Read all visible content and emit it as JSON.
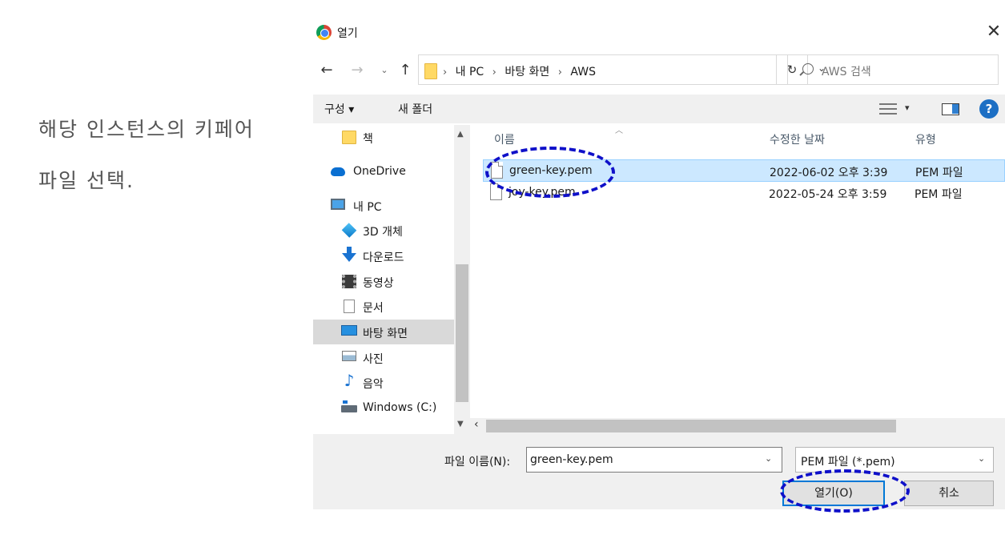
{
  "note": {
    "line1": "해당 인스턴스의 키페어",
    "line2": "파일 선택."
  },
  "dialog": {
    "title": "열기",
    "close_glyph": "✕",
    "nav": {
      "back": "←",
      "forward": "→",
      "recent": "⌄",
      "up": "↑",
      "refresh": "↻",
      "dropdown": "⌄"
    },
    "breadcrumb": [
      "내 PC",
      "바탕 화면",
      "AWS"
    ],
    "breadcrumb_sep": "›",
    "search_placeholder": "AWS 검색",
    "toolbar": {
      "organize": "구성 ▾",
      "new_folder": "새 폴더",
      "view_drop": "▾",
      "help": "?"
    },
    "nav_items": [
      {
        "label": "책",
        "icon": "folder-icon"
      },
      {
        "label": "OneDrive",
        "icon": "onedrive-icon"
      },
      {
        "label": "내 PC",
        "icon": "pc-icon"
      },
      {
        "label": "3D 개체",
        "icon": "3d-objects-icon"
      },
      {
        "label": "다운로드",
        "icon": "download-icon"
      },
      {
        "label": "동영상",
        "icon": "video-icon"
      },
      {
        "label": "문서",
        "icon": "document-icon"
      },
      {
        "label": "바탕 화면",
        "icon": "desktop-icon",
        "selected": true
      },
      {
        "label": "사진",
        "icon": "pictures-icon"
      },
      {
        "label": "음악",
        "icon": "music-icon"
      },
      {
        "label": "Windows (C:)",
        "icon": "drive-icon"
      }
    ],
    "columns": {
      "name": "이름",
      "date": "수정한 날짜",
      "type": "유형"
    },
    "files": [
      {
        "name": "green-key.pem",
        "date": "2022-06-02 오후 3:39",
        "type": "PEM 파일",
        "selected": true
      },
      {
        "name": "joy-key.pem",
        "date": "2022-05-24 오후 3:59",
        "type": "PEM 파일",
        "selected": false
      }
    ],
    "filename_label": "파일 이름(N):",
    "filename_value": "green-key.pem",
    "filter_value": "PEM 파일 (*.pem)",
    "open_button": "열기(O)",
    "cancel_button": "취소"
  },
  "colors": {
    "annotation": "#0f10c9",
    "selection": "#cce8ff",
    "accent": "#0078d7"
  }
}
